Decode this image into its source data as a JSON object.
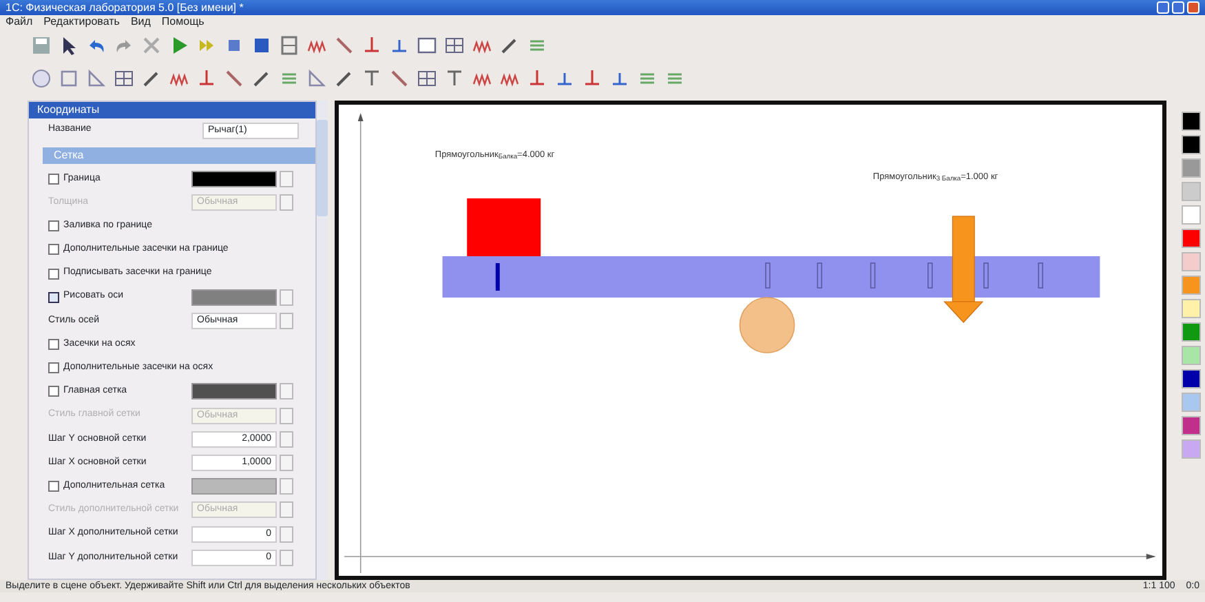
{
  "window": {
    "title": "1С: Физическая лаборатория 5.0 [Без имени] *"
  },
  "menu": [
    "Файл",
    "Редактировать",
    "Вид",
    "Помощь"
  ],
  "properties_panel": {
    "header": "Координаты",
    "name_label": "Название",
    "name_value": "Рычаг(1)",
    "section": "Сетка",
    "rows": [
      {
        "kind": "check",
        "label": "Граница",
        "checked": false,
        "disabled": false,
        "color": "#000000"
      },
      {
        "kind": "select",
        "label": "Толщина",
        "value": "Обычная",
        "disabled": true
      },
      {
        "kind": "check",
        "label": "Заливка по границе",
        "checked": false,
        "disabled": false
      },
      {
        "kind": "check",
        "label": "Дополнительные засечки на границе",
        "checked": false,
        "disabled": false
      },
      {
        "kind": "check",
        "label": "Подписывать засечки на границе",
        "checked": false,
        "disabled": false
      },
      {
        "kind": "check",
        "label": "Рисовать оси",
        "checked": true,
        "disabled": false,
        "color": "#808080"
      },
      {
        "kind": "select",
        "label": "Стиль осей",
        "value": "Обычная",
        "disabled": false
      },
      {
        "kind": "check",
        "label": "Засечки на осях",
        "checked": false,
        "disabled": false
      },
      {
        "kind": "check",
        "label": "Дополнительные засечки на осях",
        "checked": false,
        "disabled": false
      },
      {
        "kind": "check",
        "label": "Главная сетка",
        "checked": false,
        "disabled": false,
        "color": "#505050"
      },
      {
        "kind": "select",
        "label": "Стиль главной сетки",
        "value": "Обычная",
        "disabled": true
      },
      {
        "kind": "number",
        "label": "Шаг Y основной сетки",
        "value": "2,0000",
        "disabled": false
      },
      {
        "kind": "number",
        "label": "Шаг X основной сетки",
        "value": "1,0000",
        "disabled": false
      },
      {
        "kind": "check",
        "label": "Дополнительная сетка",
        "checked": false,
        "disabled": false,
        "color": "#b8b8b8"
      },
      {
        "kind": "select",
        "label": "Стиль дополнительной сетки",
        "value": "Обычная",
        "disabled": true
      },
      {
        "kind": "number",
        "label": "Шаг X дополнительной сетки",
        "value": "0",
        "disabled": false
      },
      {
        "kind": "number",
        "label": "Шаг Y дополнительной сетки",
        "value": "0",
        "disabled": false
      }
    ]
  },
  "scene": {
    "labels": [
      "Прямоугольник$_{Балка}$=4.000 кг",
      "Прямоугольник$_{3 Балка}$=1.000 кг"
    ]
  },
  "palette": [
    {
      "color": "#000000"
    },
    {
      "color": "#000000"
    },
    {
      "color": "#999999"
    },
    {
      "color": "#cccccc"
    },
    {
      "color": "#ffffff"
    },
    {
      "color": "#ff0000"
    },
    {
      "color": "#f4cccc"
    },
    {
      "color": "#f7941d"
    },
    {
      "color": "#fff2a8"
    },
    {
      "color": "#119911"
    },
    {
      "color": "#a8e6a8"
    },
    {
      "color": "#0000aa"
    },
    {
      "color": "#a8c8f0"
    },
    {
      "color": "#c0308a"
    },
    {
      "color": "#c8a8f0"
    }
  ],
  "status_bar": {
    "message": "Выделите в сцене объект. Удерживайте Shift или Ctrl для выделения нескольких объектов",
    "zoom": "1:1 100",
    "coords": "0:0"
  }
}
